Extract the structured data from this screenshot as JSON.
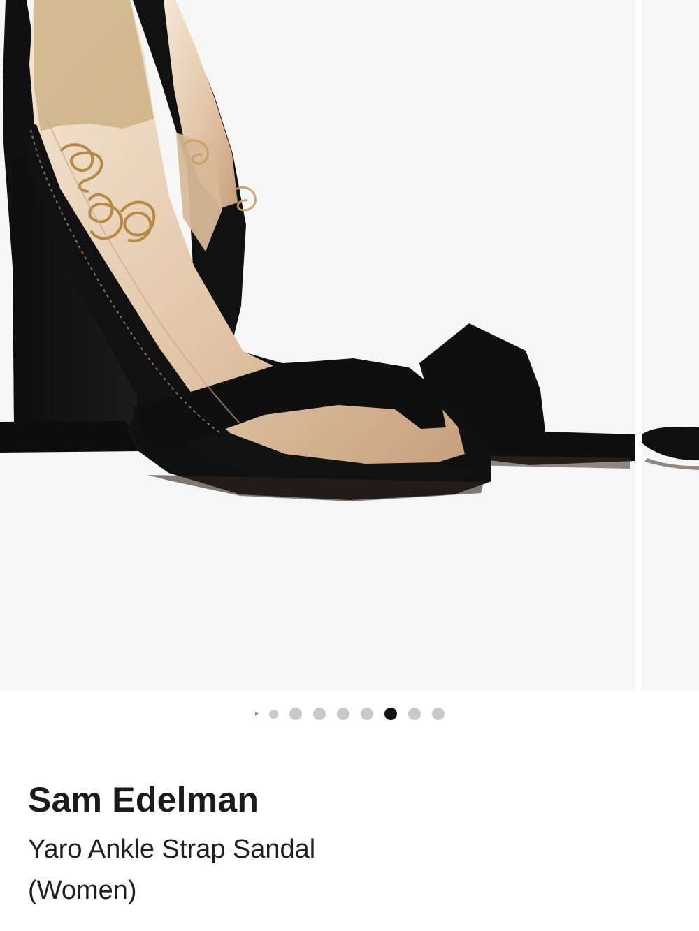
{
  "gallery": {
    "image_count": 8,
    "current_index": 6,
    "main_image_icon": "black-block-heel-sandal-image",
    "next_image_icon": "partial-sandal-image"
  },
  "product": {
    "brand": "Sam Edelman",
    "name": "Yaro Ankle Strap Sandal (Women)"
  },
  "colors": {
    "image_background": "#f6f6f6",
    "dot_inactive": "#c9c9c9",
    "dot_active": "#111111"
  }
}
